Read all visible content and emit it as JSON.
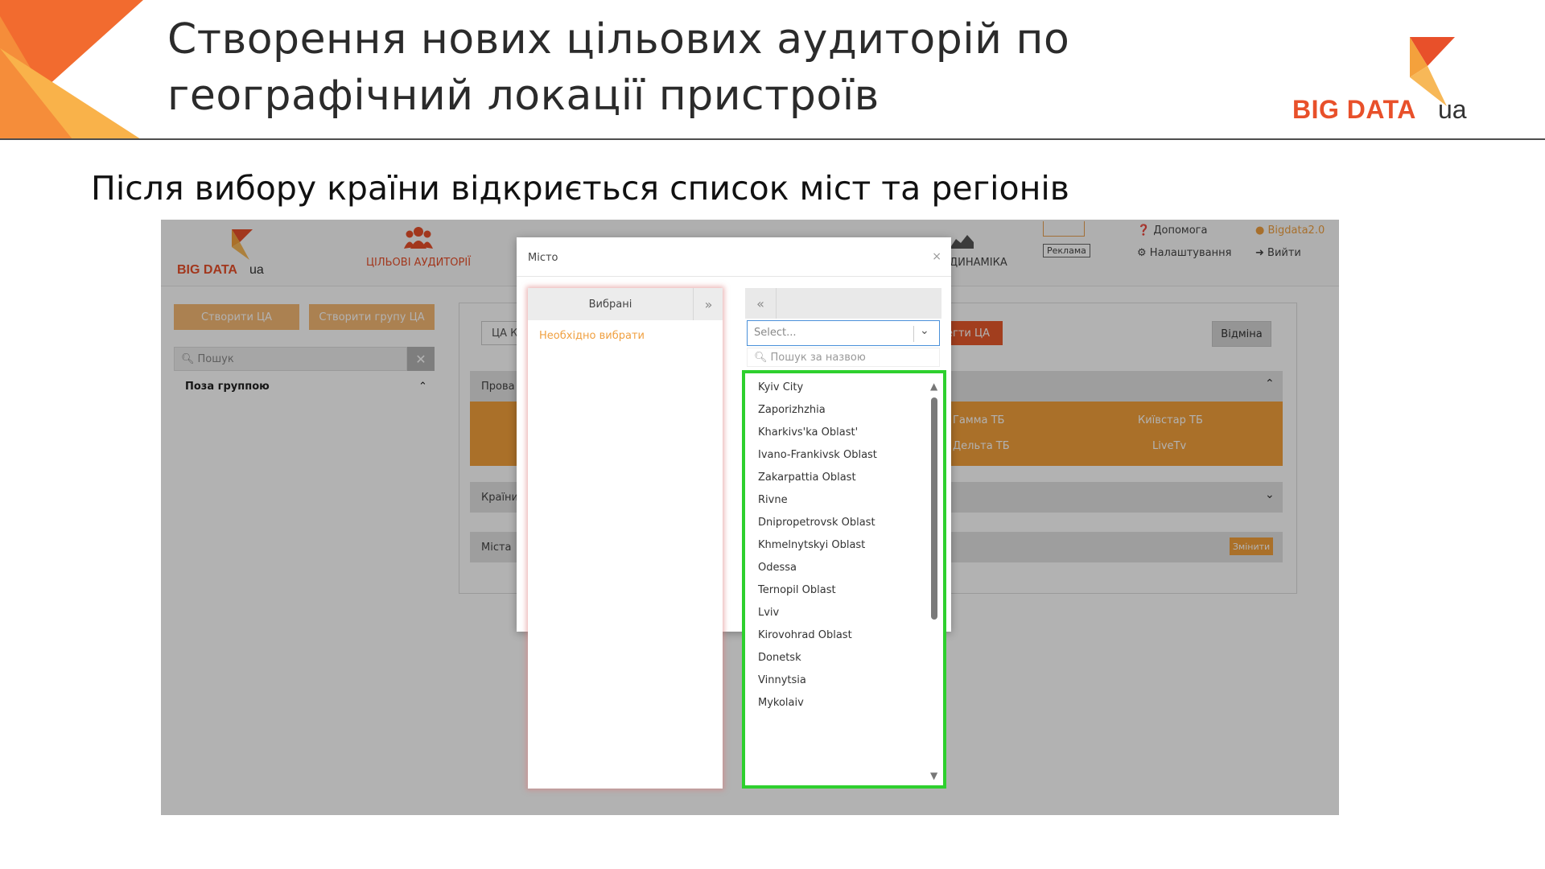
{
  "slide": {
    "title_line1": "Створення нових цільових аудиторій по",
    "title_line2": "географічний локації пристроїв",
    "subtitle": "Після вибору країни відкриється список міст та регіонів",
    "brand_word": "BIG DATA",
    "brand_suffix": "ua",
    "colors": {
      "orange": "#f4a13c",
      "red_orange": "#e8502a",
      "highlight_green": "#2ed02e"
    }
  },
  "app": {
    "logo_word": "BIG DATA",
    "logo_suffix": "ua",
    "nav": {
      "audiences_label": "ЦІЛЬОВІ АУДИТОРІЇ",
      "audiences_icon": "users-icon",
      "dynamics_label": "ДИНАМІКА",
      "ad_label": "Реклама",
      "help_label": "Допомога",
      "settings_label": "Налаштування",
      "user_label": "Bigdata2.0",
      "logout_label": "Вийти"
    },
    "sidebar": {
      "create_ca": "Створити ЦА",
      "create_group": "Створити групу ЦА",
      "search_placeholder": "Пошук",
      "group_label": "Поза группою"
    },
    "main": {
      "ca_tag": "ЦА К",
      "segment_button": "егти ЦА",
      "cancel_button": "Відміна",
      "providers_bar": "Прова",
      "providers": [
        "Гамма ТБ",
        "Київстар ТБ",
        "Дельта ТБ",
        "LiveTv"
      ],
      "countries_bar": "Країни",
      "cities_bar": "Міста",
      "change_button": "Змінити"
    },
    "modal": {
      "title": "Місто",
      "close": "×",
      "selected_header": "Вибрані",
      "selected_empty": "Необхідно вибрати",
      "select_placeholder": "Select...",
      "name_search_placeholder": "Пошук за назвою",
      "cities": [
        "Kyiv City",
        "Zaporizhzhia",
        "Kharkivs'ka Oblast'",
        "Ivano-Frankivsk Oblast",
        "Zakarpattia Oblast",
        "Rivne",
        "Dnipropetrovsk Oblast",
        "Khmelnytskyi Oblast",
        "Odessa",
        "Ternopil Oblast",
        "Lviv",
        "Kirovohrad Oblast",
        "Donetsk",
        "Vinnytsia",
        "Mykolaiv"
      ]
    }
  }
}
